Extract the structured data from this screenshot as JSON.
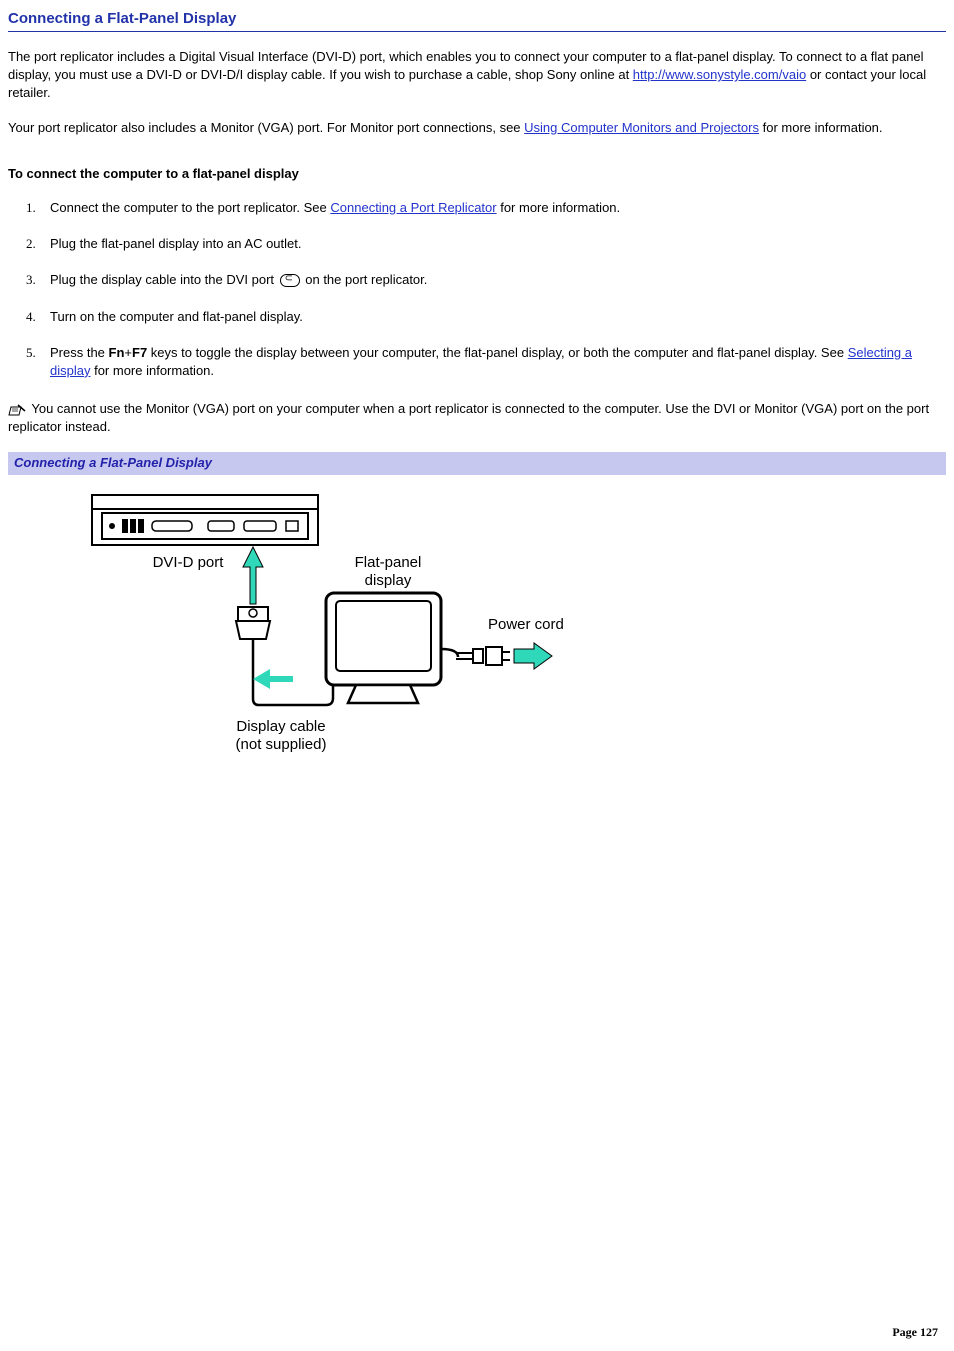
{
  "title": "Connecting a Flat-Panel Display",
  "intro": {
    "p1a": "The port replicator includes a Digital Visual Interface (DVI-D) port, which enables you to connect your computer to a flat-panel display. To connect to a flat panel display, you must use a DVI-D or DVI-D/I display cable. If you wish to purchase a cable, shop Sony online at ",
    "link1": "http://www.sonystyle.com/vaio",
    "p1b": " or contact your local retailer.",
    "p2a": "Your port replicator also includes a Monitor (VGA) port. For Monitor port connections, see ",
    "link2": "Using Computer Monitors and Projectors",
    "p2b": " for more information."
  },
  "subhead": "To connect the computer to a flat-panel display",
  "steps": {
    "s1a": "Connect the computer to the port replicator. See ",
    "s1link": "Connecting a Port Replicator",
    "s1b": " for more information.",
    "s2": "Plug the flat-panel display into an AC outlet.",
    "s3a": "Plug the display cable into the DVI port ",
    "s3b": " on the port replicator.",
    "s4": "Turn on the computer and flat-panel display.",
    "s5a": "Press the ",
    "s5fn": "Fn",
    "s5plus": "+",
    "s5f7": "F7",
    "s5b": " keys to toggle the display between your computer, the flat-panel display, or both the computer and flat-panel display. See ",
    "s5link": "Selecting a display",
    "s5c": " for more information."
  },
  "note": " You cannot use the Monitor (VGA) port on your computer when a port replicator is connected to the computer. Use the DVI or Monitor (VGA) port on the port replicator instead.",
  "caption": "Connecting a Flat-Panel Display",
  "diagram": {
    "dvi_label": "DVI-D port",
    "monitor_t1": "Flat-panel",
    "monitor_t2": "display",
    "power_label": "Power cord",
    "cable_t1": "Display cable",
    "cable_t2": "(not supplied)"
  },
  "footer": "Page 127"
}
